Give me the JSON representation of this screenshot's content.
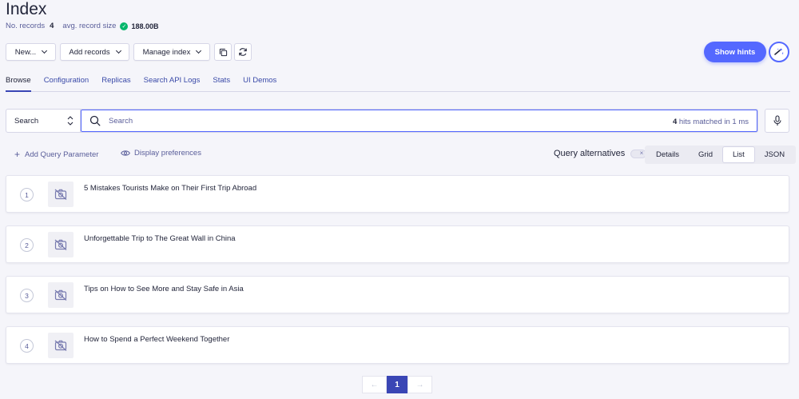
{
  "header": {
    "title": "Index",
    "records_label": "No. records",
    "records_value": "4",
    "avg_size_label": "avg. record size",
    "avg_size_value": "188.00B"
  },
  "toolbar": {
    "new_label": "New...",
    "add_records_label": "Add records",
    "manage_index_label": "Manage index",
    "show_hints_label": "Show hints"
  },
  "tabs": [
    {
      "label": "Browse",
      "active": true
    },
    {
      "label": "Configuration"
    },
    {
      "label": "Replicas"
    },
    {
      "label": "Search API Logs"
    },
    {
      "label": "Stats"
    },
    {
      "label": "UI Demos"
    }
  ],
  "search": {
    "selector_value": "Search",
    "placeholder": "Search",
    "hits_count": "4",
    "hits_text": "hits matched in 1 ms"
  },
  "controls": {
    "add_query_param_label": "Add Query Parameter",
    "display_prefs_label": "Display preferences",
    "query_alternatives_label": "Query alternatives",
    "view_options": [
      "Details",
      "Grid",
      "List",
      "JSON"
    ],
    "active_view": "List"
  },
  "hits": [
    {
      "position": "1",
      "title": "5 Mistakes Tourists Make on Their First Trip Abroad"
    },
    {
      "position": "2",
      "title": "Unforgettable Trip to The Great Wall in China"
    },
    {
      "position": "3",
      "title": "Tips on How to See More and Stay Safe in Asia"
    },
    {
      "position": "4",
      "title": "How to Spend a Perfect Weekend Together"
    }
  ],
  "pagination": {
    "prev": "←",
    "current": "1",
    "next": "→"
  },
  "colors": {
    "accent": "#5468ff",
    "active_tab": "#3a46b5",
    "success": "#06b66b"
  }
}
